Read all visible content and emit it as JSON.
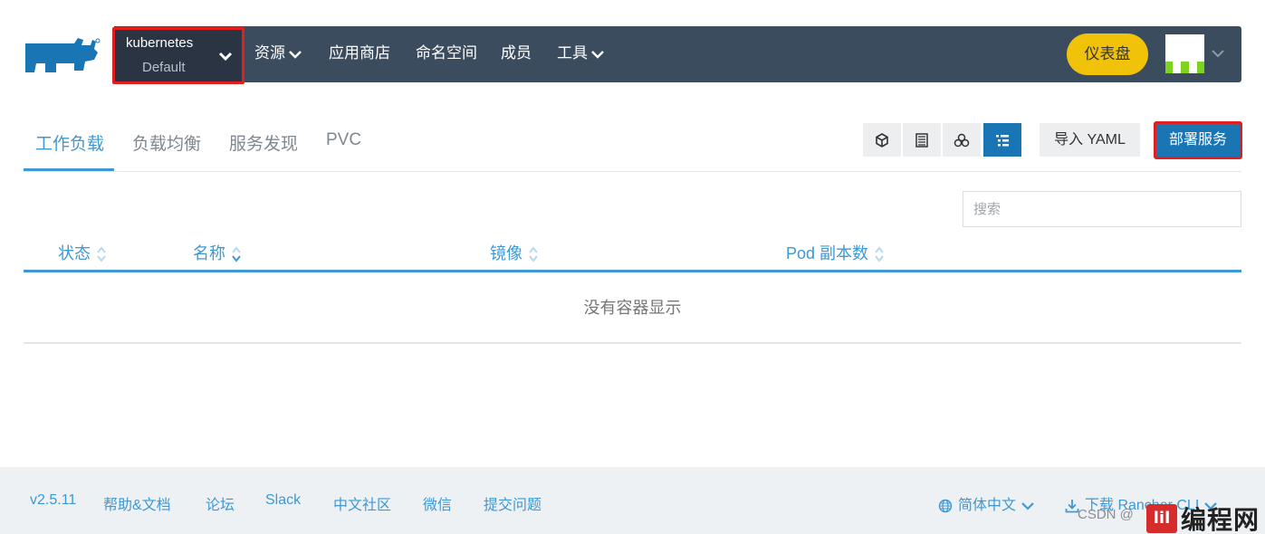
{
  "header": {
    "cluster_name": "kubernetes",
    "project_name": "Default",
    "nav": [
      {
        "label": "资源",
        "has_dropdown": true
      },
      {
        "label": "应用商店",
        "has_dropdown": false
      },
      {
        "label": "命名空间",
        "has_dropdown": false
      },
      {
        "label": "成员",
        "has_dropdown": false
      },
      {
        "label": "工具",
        "has_dropdown": true
      }
    ],
    "dashboard_label": "仪表盘"
  },
  "tabs": [
    {
      "label": "工作负载",
      "active": true
    },
    {
      "label": "负载均衡",
      "active": false
    },
    {
      "label": "服务发现",
      "active": false
    },
    {
      "label": "PVC",
      "active": false
    }
  ],
  "toolbar": {
    "view_icons": [
      "cube-icon",
      "list-flat-icon",
      "cluster-icon",
      "list-detailed-icon"
    ],
    "active_view": "list-detailed-icon",
    "import_label": "导入 YAML",
    "deploy_label": "部署服务"
  },
  "search": {
    "placeholder": "搜索",
    "value": ""
  },
  "table": {
    "columns": [
      "状态",
      "名称",
      "镜像",
      "Pod 副本数"
    ],
    "empty_message": "没有容器显示"
  },
  "footer": {
    "version": "v2.5.11",
    "links": [
      "帮助&文档",
      "论坛",
      "Slack",
      "中文社区",
      "微信",
      "提交问题"
    ],
    "language": "简体中文",
    "download": "下载 Rancher CLI",
    "watermark": "CSDN @",
    "brand_badge": "lil",
    "brand_text": "编程网"
  },
  "colors": {
    "navbar": "#3c4c5f",
    "accent": "#3d98d3",
    "primary_button": "#1a75b5",
    "dashboard_button": "#f0c20a",
    "highlight_border": "#e0201f"
  }
}
